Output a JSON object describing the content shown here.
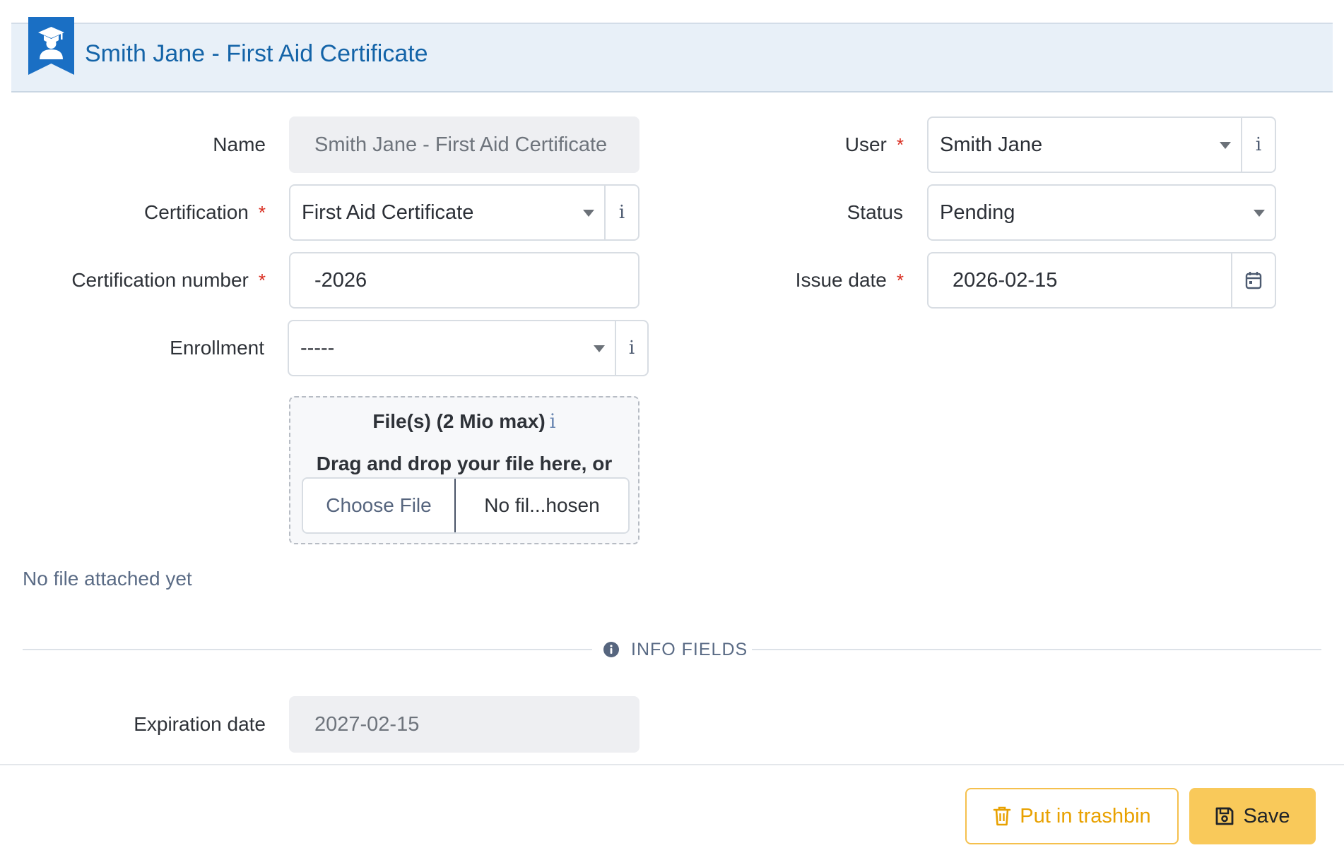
{
  "header": {
    "title": "Smith Jane - First Aid Certificate",
    "icon": "certificate-badge-icon",
    "accent_color": "#1464a8"
  },
  "form": {
    "name": {
      "label": "Name",
      "value": "Smith Jane - First Aid Certificate"
    },
    "certification": {
      "label": "Certification",
      "value": "First Aid Certificate",
      "info": "i"
    },
    "certification_number": {
      "label": "Certification number",
      "value": "-2026"
    },
    "enrollment": {
      "label": "Enrollment",
      "value": "-----",
      "info": "i"
    },
    "user": {
      "label": "User",
      "value": "Smith Jane",
      "info": "i"
    },
    "status": {
      "label": "Status",
      "value": "Pending"
    },
    "issue_date": {
      "label": "Issue date",
      "value": "2026-02-15"
    },
    "required_mark": "*"
  },
  "files": {
    "title": "File(s) (2 Mio max)",
    "info": "i",
    "subtitle": "Drag and drop your file here, or",
    "choose_label": "Choose File",
    "file_name": "No fil...hosen",
    "empty_text": "No file attached yet"
  },
  "info_fields": {
    "heading": "INFO FIELDS",
    "expiration_date": {
      "label": "Expiration date",
      "value": "2027-02-15"
    }
  },
  "actions": {
    "trash_label": "Put in trashbin",
    "save_label": "Save",
    "button_color": "#f9c95a"
  }
}
